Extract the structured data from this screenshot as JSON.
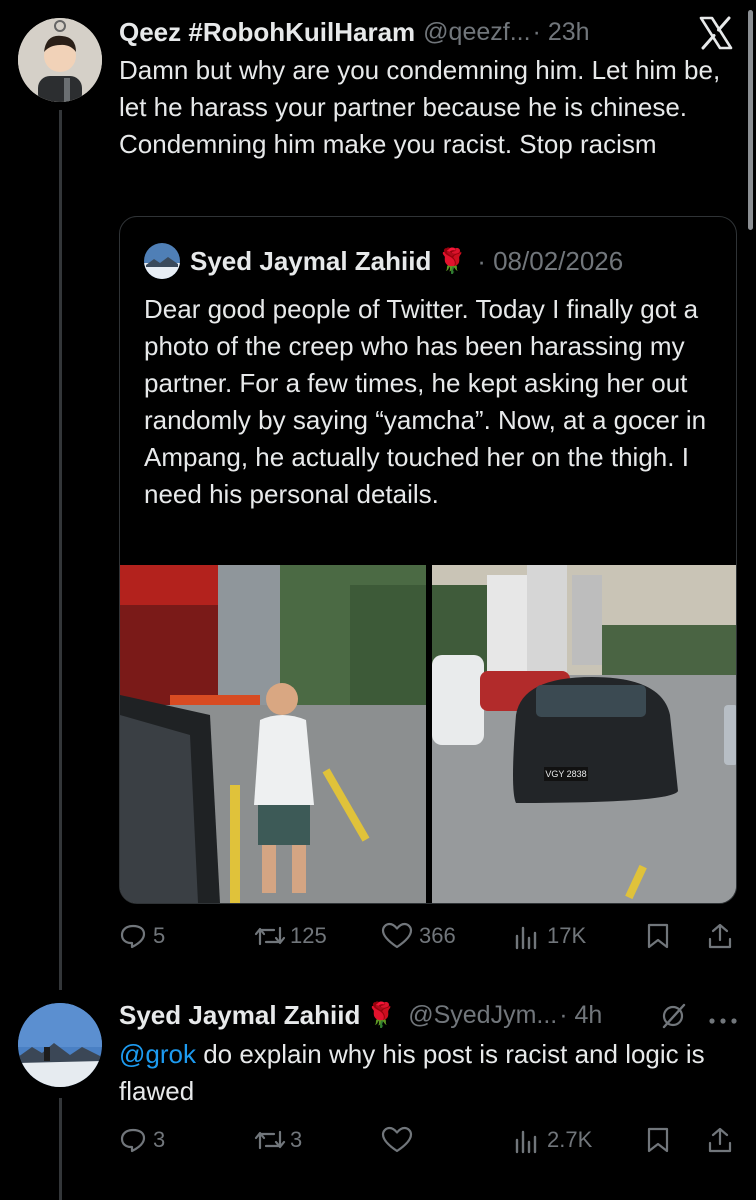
{
  "post": {
    "author_name": "Qeez #RobohKuilHaram",
    "author_handle": "@qeezf...",
    "time": "· 23h",
    "text": "Damn but why are you condemning him. Let him be, let he harass your partner because he is chinese. Condemning him make you racist. Stop racism",
    "brand_icon": "x-logo-icon"
  },
  "quote": {
    "author_name": "Syed Jaymal Zahiid",
    "author_emoji": "🌹",
    "date": "· 08/02/2026",
    "text": "Dear good people of Twitter. Today I finally got a photo of the creep who has been harassing my partner. For a few times, he kept asking her out randomly by saying “yamcha”. Now, at a gocer in Ampang, he actually touched her on the thigh. I need his personal details.",
    "plate": "VGY 2838"
  },
  "post_actions": {
    "replies": "5",
    "reposts": "125",
    "likes": "366",
    "views": "17K"
  },
  "reply": {
    "author_name": "Syed Jaymal Zahiid",
    "author_emoji": "🌹",
    "author_handle": "@SyedJym...",
    "time": "· 4h",
    "mention": "@grok",
    "text": " do explain why his post is racist and logic is flawed"
  },
  "reply_actions": {
    "replies": "3",
    "reposts": "3",
    "likes": "",
    "views": "2.7K"
  },
  "colors": {
    "background": "#000000",
    "text": "#e7e9ea",
    "muted": "#71767b",
    "link": "#1d9bf0",
    "border": "#2f3336"
  }
}
